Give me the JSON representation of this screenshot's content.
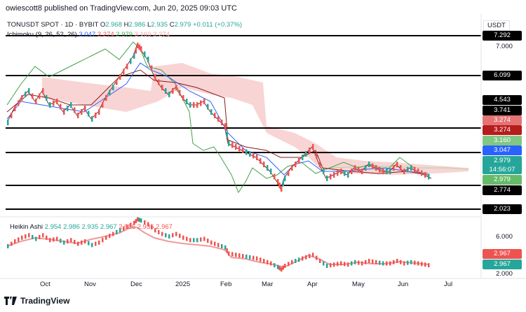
{
  "header": {
    "text": "owiescott8 published on TradingView.com, Jun 20, 2025 09:03 UTC"
  },
  "symbol": {
    "pair": "TONUSDT SPOT · 1D · BYBIT",
    "o_label": "O",
    "o": "2.968",
    "h_label": "H",
    "h": "2.986",
    "l_label": "L",
    "l": "2.935",
    "c_label": "C",
    "c": "2.979",
    "change": "+0.011 (+0.37%)"
  },
  "ichimoku": {
    "label": "Ichimoku (9, 26, 52, 26)",
    "v1": "3.047",
    "v2": "3.274",
    "v3": "2.979",
    "v4": "3.160",
    "v5": "3.274"
  },
  "heikin": {
    "label": "Heikin Ashi",
    "v1": "2.954",
    "v2": "2.986",
    "v3": "2.935",
    "v4": "2.967",
    "v5": "2.986",
    "v6": "2.935",
    "v7": "2.967"
  },
  "currency": "USDT",
  "price_axis": {
    "t1": "7.292",
    "t2": "7.000",
    "t3": "6.099",
    "t4": "4.543",
    "t5": "3.741",
    "t6": "3.274",
    "t7": "3.274",
    "t8": "3.160",
    "t9": "3.047",
    "t10": "2.979",
    "t11": "14:56:07",
    "t12": "2.979",
    "t13": "2.774",
    "t14": "2.023"
  },
  "lower_axis": {
    "t1": "6.000",
    "t2": "2.967",
    "t3": "2.967",
    "t4": "2.000"
  },
  "time_axis": [
    "Oct",
    "Nov",
    "Dec",
    "2025",
    "Feb",
    "Mar",
    "Apr",
    "May",
    "Jun",
    "Jul"
  ],
  "footer": {
    "brand": "TradingView"
  },
  "colors": {
    "up": "#26a69a",
    "down": "#ef5350",
    "kumo": "#f7b3b3",
    "tenkan": "#2962ff",
    "kijun": "#b71c1c",
    "chikou": "#43a047"
  },
  "chart_data": {
    "type": "line",
    "title": "TONUSDT SPOT · 1D · BYBIT",
    "horizontal_levels": [
      7.292,
      6.099,
      3.741,
      3.047,
      2.774,
      2.023
    ],
    "price_path": [
      {
        "x": "2024-09-10",
        "y": 5.5
      },
      {
        "x": "2024-09-25",
        "y": 5.8
      },
      {
        "x": "2024-10-10",
        "y": 5.3
      },
      {
        "x": "2024-10-25",
        "y": 5.1
      },
      {
        "x": "2024-11-10",
        "y": 5.4
      },
      {
        "x": "2024-11-25",
        "y": 6.2
      },
      {
        "x": "2024-12-05",
        "y": 7.0
      },
      {
        "x": "2024-12-20",
        "y": 5.9
      },
      {
        "x": "2025-01-05",
        "y": 5.5
      },
      {
        "x": "2025-01-25",
        "y": 5.2
      },
      {
        "x": "2025-02-05",
        "y": 3.9
      },
      {
        "x": "2025-02-25",
        "y": 3.6
      },
      {
        "x": "2025-03-10",
        "y": 2.8
      },
      {
        "x": "2025-03-25",
        "y": 3.6
      },
      {
        "x": "2025-04-10",
        "y": 3.0
      },
      {
        "x": "2025-05-01",
        "y": 3.2
      },
      {
        "x": "2025-05-20",
        "y": 3.1
      },
      {
        "x": "2025-06-05",
        "y": 3.2
      },
      {
        "x": "2025-06-20",
        "y": 2.979
      }
    ]
  }
}
